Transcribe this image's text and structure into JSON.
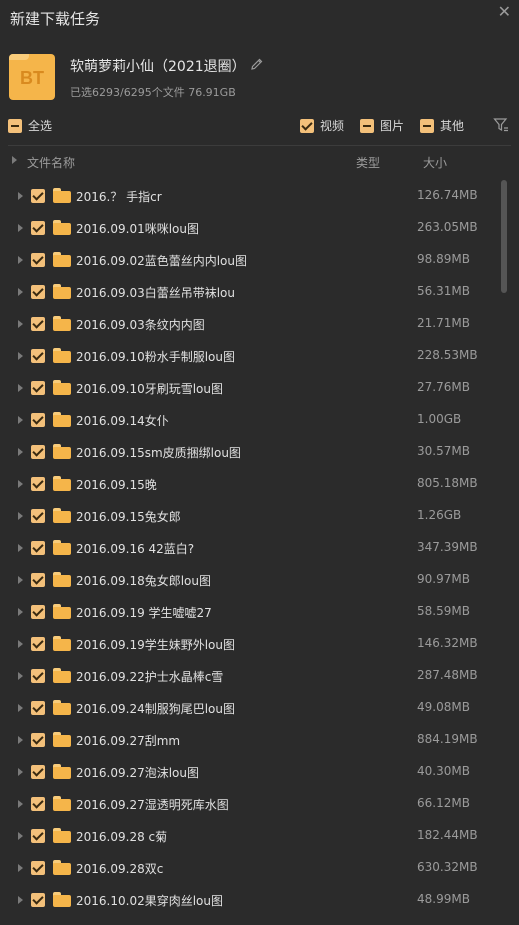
{
  "window": {
    "title": "新建下载任务",
    "close_glyph": "✕"
  },
  "torrent": {
    "badge": "BT",
    "name": "软萌萝莉小仙（2021退圈）",
    "summary": "已选6293/6295个文件 76.91GB"
  },
  "filters": {
    "select_all": "全选",
    "video": "视频",
    "image": "图片",
    "other": "其他"
  },
  "columns": {
    "name": "文件名称",
    "type": "类型",
    "size": "大小"
  },
  "colors": {
    "accent": "#f3c07a",
    "folder": "#f5b54a",
    "background": "#2b2b2b"
  },
  "files": [
    {
      "name": "2016.？ 手指cr",
      "size": "126.74MB"
    },
    {
      "name": "2016.09.01咪咪lou图",
      "size": "263.05MB"
    },
    {
      "name": "2016.09.02蓝色蕾丝内内lou图",
      "size": "98.89MB"
    },
    {
      "name": "2016.09.03白蕾丝吊带袜lou",
      "size": "56.31MB"
    },
    {
      "name": "2016.09.03条纹内内图",
      "size": "21.71MB"
    },
    {
      "name": "2016.09.10粉水手制服lou图",
      "size": "228.53MB"
    },
    {
      "name": "2016.09.10牙刷玩雪lou图",
      "size": "27.76MB"
    },
    {
      "name": "2016.09.14女仆",
      "size": "1.00GB"
    },
    {
      "name": "2016.09.15sm皮质捆绑lou图",
      "size": "30.57MB"
    },
    {
      "name": "2016.09.15晚",
      "size": "805.18MB"
    },
    {
      "name": "2016.09.15兔女郎",
      "size": "1.26GB"
    },
    {
      "name": "2016.09.16 42蓝白?",
      "size": "347.39MB"
    },
    {
      "name": "2016.09.18兔女郎lou图",
      "size": "90.97MB"
    },
    {
      "name": "2016.09.19 学生嘘嘘27",
      "size": "58.59MB"
    },
    {
      "name": "2016.09.19学生妹野外lou图",
      "size": "146.32MB"
    },
    {
      "name": "2016.09.22护士水晶棒c雪",
      "size": "287.48MB"
    },
    {
      "name": "2016.09.24制服狗尾巴lou图",
      "size": "49.08MB"
    },
    {
      "name": "2016.09.27刮mm",
      "size": "884.19MB"
    },
    {
      "name": "2016.09.27泡沫lou图",
      "size": "40.30MB"
    },
    {
      "name": "2016.09.27湿透明死库水图",
      "size": "66.12MB"
    },
    {
      "name": "2016.09.28 c菊",
      "size": "182.44MB"
    },
    {
      "name": "2016.09.28双c",
      "size": "630.32MB"
    },
    {
      "name": "2016.10.02果穿肉丝lou图",
      "size": "48.99MB"
    }
  ]
}
